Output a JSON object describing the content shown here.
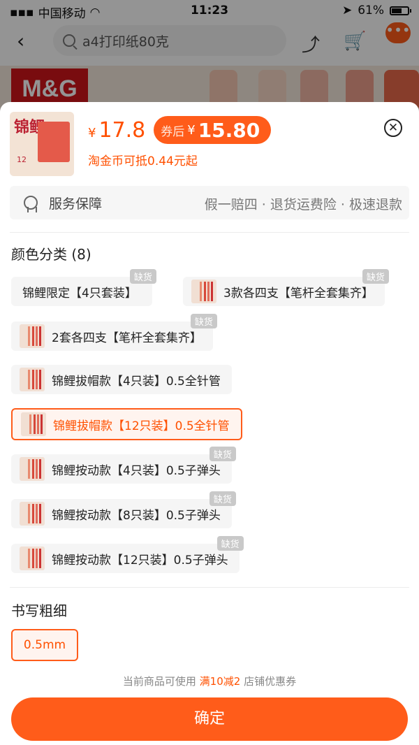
{
  "status_bar": {
    "carrier": "中国移动",
    "time": "11:23",
    "battery": "61%"
  },
  "nav": {
    "search_text": "a4打印纸80克",
    "more_label": "•••"
  },
  "banner": {
    "brand": "M&G"
  },
  "product": {
    "thumb_title": "锦鲤",
    "thumb_count": "12",
    "currency": "¥",
    "price": "17.8",
    "coupon_label": "券后",
    "coupon_price": "15.80",
    "coin_text": "淘金币可抵0.44元起"
  },
  "service": {
    "label": "服务保障",
    "detail": "假一赔四 · 退货运费险 · 极速退款"
  },
  "color_section": {
    "title": "颜色分类 (8)",
    "out_of_stock_label": "缺货",
    "options": [
      {
        "label": "锦鲤限定【4只套装】",
        "has_image": false,
        "out_of_stock": true,
        "selected": false
      },
      {
        "label": "3款各四支【笔杆全套集齐】",
        "has_image": true,
        "out_of_stock": true,
        "selected": false
      },
      {
        "label": "2套各四支【笔杆全套集齐】",
        "has_image": true,
        "out_of_stock": true,
        "selected": false
      },
      {
        "label": "锦鲤拔帽款【4只装】0.5全针管",
        "has_image": true,
        "out_of_stock": false,
        "selected": false
      },
      {
        "label": "锦鲤拔帽款【12只装】0.5全针管",
        "has_image": true,
        "out_of_stock": false,
        "selected": true
      },
      {
        "label": "锦鲤按动款【4只装】0.5子弹头",
        "has_image": true,
        "out_of_stock": true,
        "selected": false
      },
      {
        "label": "锦鲤按动款【8只装】0.5子弹头",
        "has_image": true,
        "out_of_stock": true,
        "selected": false
      },
      {
        "label": "锦鲤按动款【12只装】0.5子弹头",
        "has_image": true,
        "out_of_stock": true,
        "selected": false
      }
    ]
  },
  "size_section": {
    "title": "书写粗细",
    "option": "0.5mm"
  },
  "coupon_note": {
    "prefix": "当前商品可使用",
    "highlight": "满10减2",
    "suffix": "店铺优惠券"
  },
  "confirm_label": "确定",
  "colors": {
    "accent": "#ff5c1a",
    "price": "#ff5000",
    "brand_red": "#d0161b"
  }
}
